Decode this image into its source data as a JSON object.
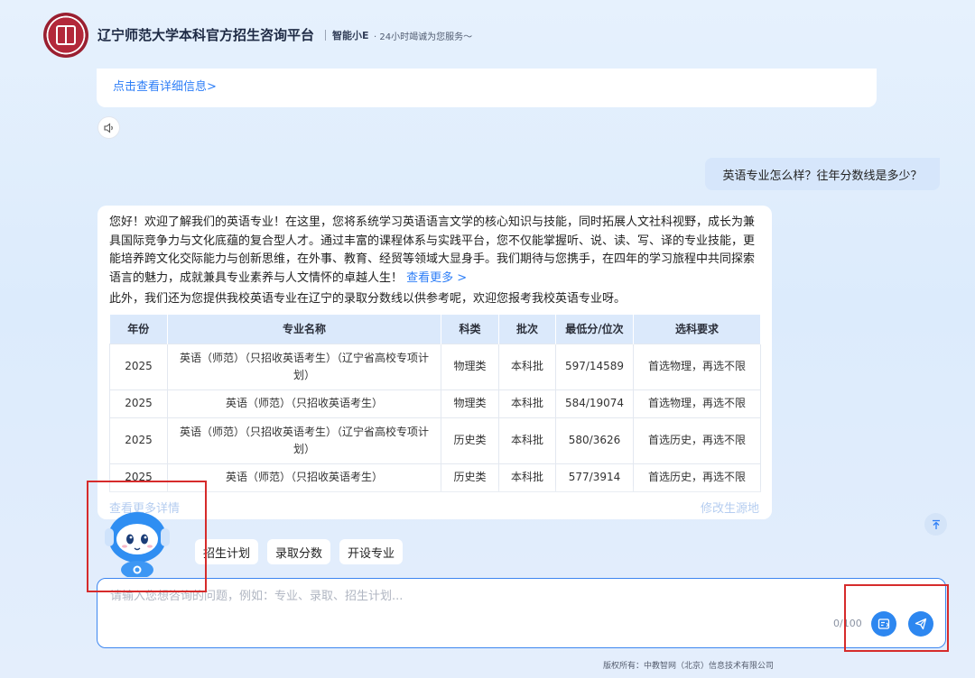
{
  "header": {
    "title": "辽宁师范大学本科官方招生咨询平台",
    "assistant_name": "智能小E",
    "tagline": "· 24小时竭诚为您服务～"
  },
  "previous_card": {
    "detail_link": "点击查看详细信息>"
  },
  "conversation": {
    "user_question": "英语专业怎么样？往年分数线是多少？",
    "answer": {
      "intro": "您好！欢迎了解我们的英语专业！在这里，您将系统学习英语语言文学的核心知识与技能，同时拓展人文社科视野，成长为兼具国际竞争力与文化底蕴的复合型人才。通过丰富的课程体系与实践平台，您不仅能掌握听、说、读、写、译的专业技能，更能培养跨文化交际能力与创新思维，在外事、教育、经贸等领域大显身手。我们期待与您携手，在四年的学习旅程中共同探索语言的魅力，成就兼具专业素养与人文情怀的卓越人生！",
      "see_more": "查看更多 >",
      "outro": "此外，我们还为您提供我校英语专业在辽宁的录取分数线以供参考呢，欢迎您报考我校英语专业呀。",
      "table": {
        "headers": [
          "年份",
          "专业名称",
          "科类",
          "批次",
          "最低分/位次",
          "选科要求"
        ],
        "rows": [
          [
            "2025",
            "英语（师范）（只招收英语考生）（辽宁省高校专项计划）",
            "物理类",
            "本科批",
            "597/14589",
            "首选物理，再选不限"
          ],
          [
            "2025",
            "英语（师范）（只招收英语考生）",
            "物理类",
            "本科批",
            "584/19074",
            "首选物理，再选不限"
          ],
          [
            "2025",
            "英语（师范）（只招收英语考生）（辽宁省高校专项计划）",
            "历史类",
            "本科批",
            "580/3626",
            "首选历史，再选不限"
          ],
          [
            "2025",
            "英语（师范）（只招收英语考生）",
            "历史类",
            "本科批",
            "577/3914",
            "首选历史，再选不限"
          ]
        ]
      },
      "view_detail": "查看更多详情",
      "change_source": "修改生源地"
    }
  },
  "quick_chips": [
    "招生计划",
    "录取分数",
    "开设专业"
  ],
  "input": {
    "placeholder": "请输入您想咨询的问题，例如：专业、录取、招生计划...",
    "value": "",
    "counter": "0/100"
  },
  "footer": {
    "copyright": "版权所有：中教智网（北京）信息技术有限公司"
  },
  "icons": {
    "speaker": "speaker-icon",
    "scroll_top": "arrow-up-icon",
    "quick_question": "chat-list-icon",
    "send": "send-plane-icon"
  },
  "colors": {
    "accent": "#2d87f0",
    "link": "#2d7ef7",
    "highlight_box": "#d62b2b"
  }
}
